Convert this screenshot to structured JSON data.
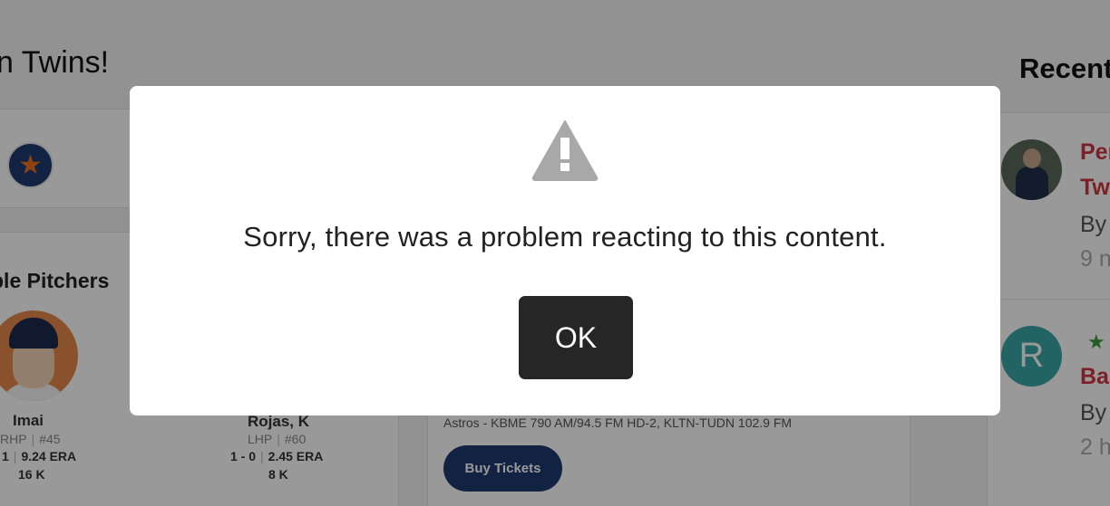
{
  "page": {
    "headline": "n Twins!",
    "section_title": "ble Pitchers",
    "pitchers": [
      {
        "name": "Imai",
        "position": "RHP",
        "number": "#45",
        "record": "1",
        "era": "9.24 ERA",
        "strikeouts": "16 K"
      },
      {
        "name": "Rojas, K",
        "position": "LHP",
        "number": "#60",
        "record": "1 - 0",
        "era": "2.45 ERA",
        "strikeouts": "8 K"
      }
    ],
    "broadcast": "Astros - KBME 790 AM/94.5 FM HD-2, KLTN-TUDN 102.9 FM",
    "buy_tickets_label": "Buy Tickets",
    "recent_title": "Recent",
    "recent_items": [
      {
        "title_line1": "Per",
        "title_line2": "Tw",
        "by": "By",
        "time": "9 n"
      },
      {
        "avatar_letter": "R",
        "title_line1": "Bas",
        "by": "By",
        "time": "2 h"
      }
    ]
  },
  "modal": {
    "icon": "warning-icon",
    "message": "Sorry, there was a problem reacting to this content.",
    "ok_label": "OK"
  },
  "colors": {
    "overlay": "rgba(0,0,0,0.4)",
    "ok_button_bg": "#262626",
    "warning_icon": "#a8a8a8",
    "astros_navy": "#1d3a6e",
    "astros_orange": "#eb6e1f",
    "link_red": "#d0343e"
  }
}
